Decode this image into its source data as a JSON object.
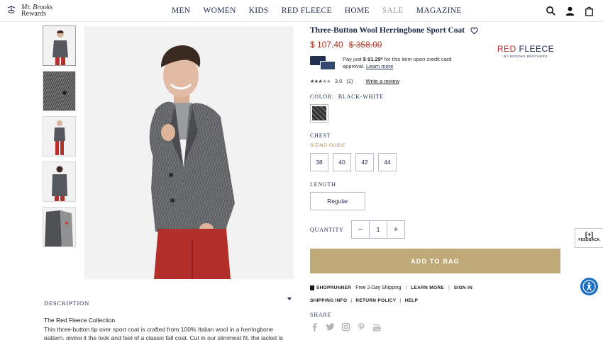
{
  "header": {
    "logo_line1": "Mr. Brooks",
    "logo_line2": "Rewards",
    "nav": [
      "MEN",
      "WOMEN",
      "KIDS",
      "RED FLEECE",
      "HOME",
      "SALE",
      "MAGAZINE"
    ]
  },
  "icons": [
    "search-icon",
    "account-icon",
    "bag-icon",
    "heart-icon",
    "chevron-down-icon",
    "feedback-icon",
    "accessibility-icon"
  ],
  "product": {
    "title": "Three-Button Wool Herringbone Sport Coat",
    "price_now": "$ 107.40",
    "price_was": "$ 358.00",
    "brand_logo_main": "RED FLEECE",
    "brand_logo_sub": "BY BROOKS BROTHERS",
    "card_offer_prefix": "Pay just ",
    "card_offer_amount": "$ 91.29*",
    "card_offer_suffix": " for this item upon credit card approval. ",
    "card_offer_link": "Learn more",
    "rating_value": "3.0",
    "rating_count": "(1)",
    "rating_stars": 3,
    "write_review": "Write a review",
    "color_label": "COLOR:",
    "color_value": "BLACK-WHITE",
    "chest_label": "CHEST",
    "sizing_guide": "SIZING GUIDE",
    "sizes": [
      "38",
      "40",
      "42",
      "44"
    ],
    "length_label": "LENGTH",
    "length_value": "Regular",
    "quantity_label": "QUANTITY",
    "quantity": "1",
    "add_to_bag": "ADD TO BAG"
  },
  "shipping": {
    "shoprunner": "SHOPRUNNER",
    "free_shipping": "Free 2-Day Shipping",
    "learn_more": "LEARN MORE",
    "sign_in": "SIGN IN",
    "shipping_info": "SHIPPING INFO",
    "return_policy": "RETURN POLICY",
    "help": "HELP"
  },
  "share": {
    "label": "SHARE",
    "networks": [
      "f",
      "t",
      "ig",
      "p",
      "yt"
    ]
  },
  "description": {
    "label": "DESCRIPTION",
    "subtitle": "The Red Fleece Collection",
    "body": "This three-button tip over sport coat is crafted from 100% Italian wool in a herringbone pattern, giving it the look and feel of a classic fall coat. Cut in our slimmest fit, the jacket is tailored with"
  },
  "feedback": {
    "icon_text": "[+]",
    "label": "FEEDBACK"
  },
  "colors": {
    "navy": "#1e2a4a",
    "price_red": "#a62d1e",
    "gold_button": "#c0a979",
    "access_blue": "#1a6fc4"
  }
}
